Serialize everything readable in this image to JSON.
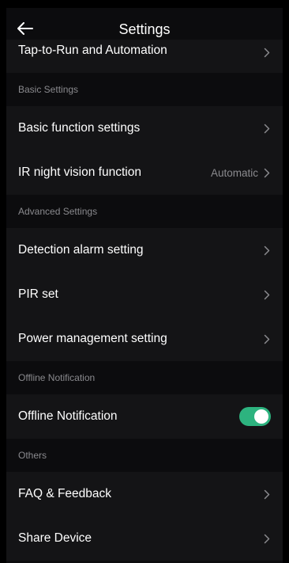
{
  "header": {
    "title": "Settings",
    "back_icon": "arrow-left-icon"
  },
  "top_item": {
    "label": "Tap-to-Run and Automation"
  },
  "sections": [
    {
      "title": "Basic Settings",
      "items": [
        {
          "label": "Basic function settings",
          "value": ""
        },
        {
          "label": "IR night vision function",
          "value": "Automatic"
        }
      ]
    },
    {
      "title": "Advanced Settings",
      "items": [
        {
          "label": "Detection alarm setting",
          "value": ""
        },
        {
          "label": "PIR set",
          "value": ""
        },
        {
          "label": "Power management setting",
          "value": ""
        }
      ]
    },
    {
      "title": "Offline Notification",
      "items": [
        {
          "label": "Offline Notification",
          "toggle_on": true
        }
      ]
    },
    {
      "title": "Others",
      "items": [
        {
          "label": "FAQ & Feedback",
          "value": ""
        },
        {
          "label": "Share Device",
          "value": ""
        }
      ]
    }
  ],
  "colors": {
    "toggle_on": "#2db37f",
    "background": "#0c0c0e",
    "row_background": "#141416",
    "secondary_text": "#8a8a8e"
  }
}
